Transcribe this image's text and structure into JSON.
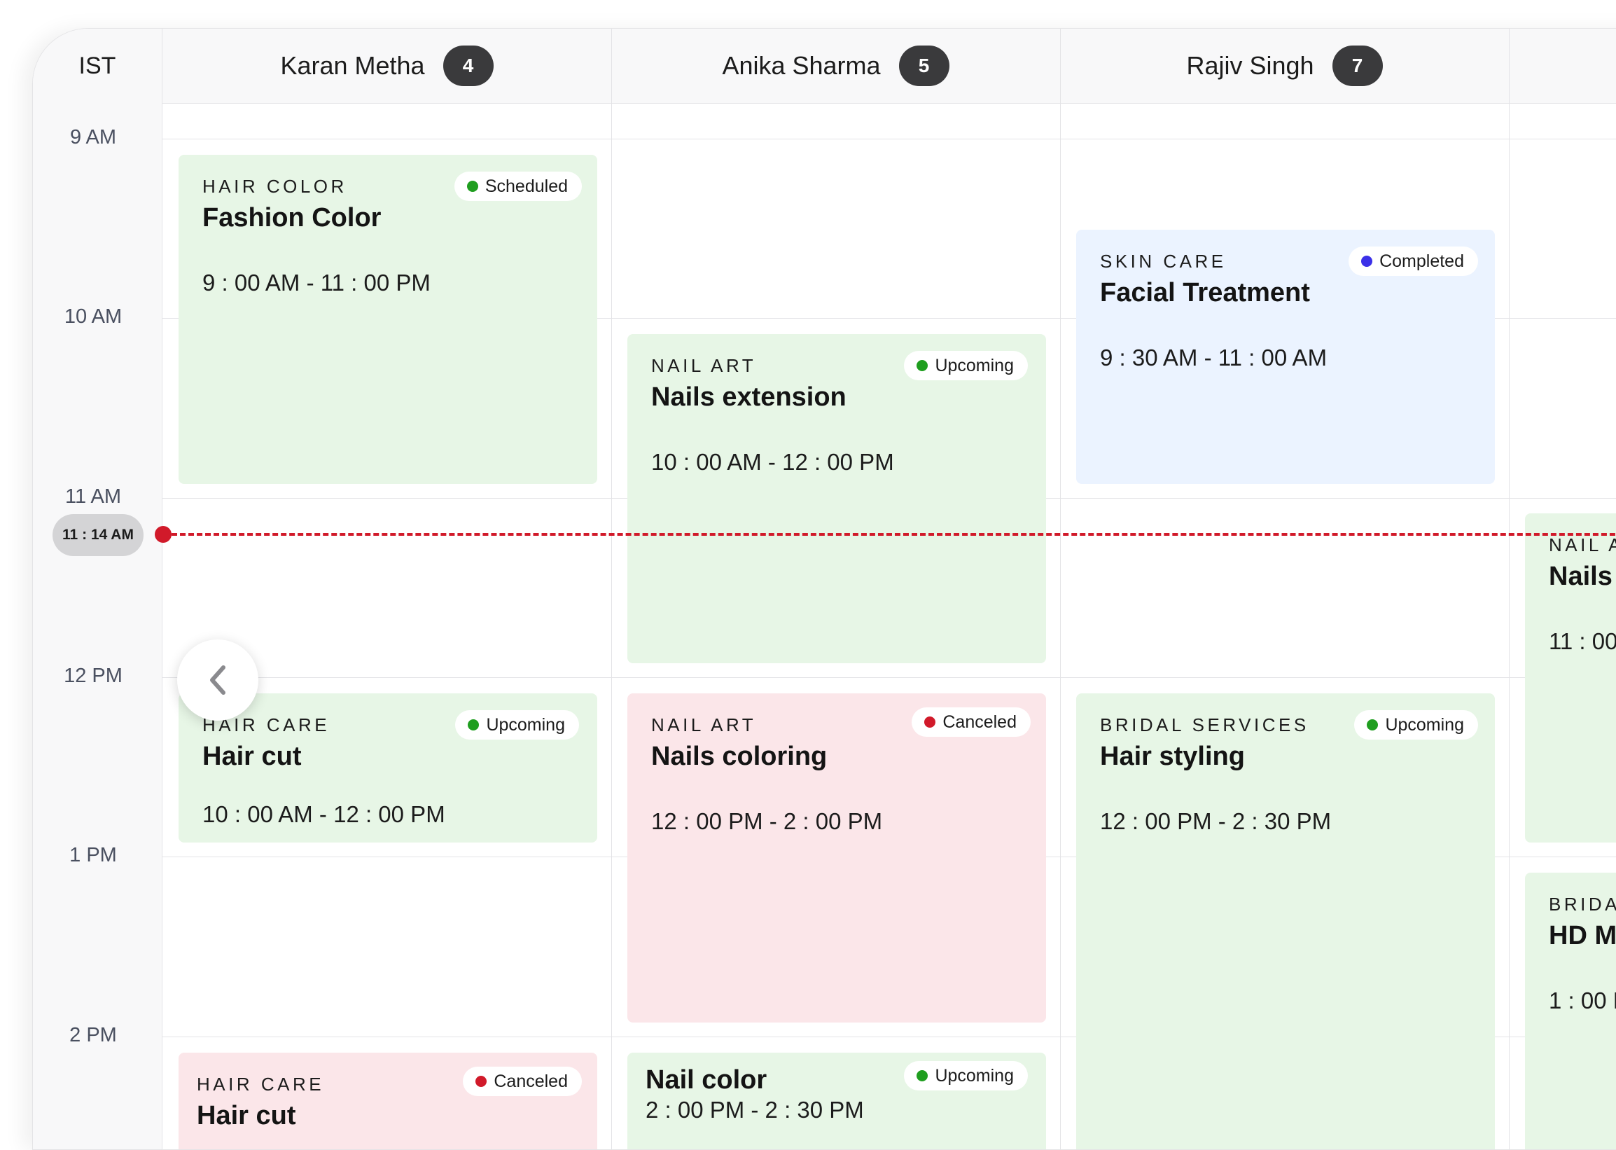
{
  "timezone": "IST",
  "staff": [
    {
      "name": "Karan Metha",
      "count": "4"
    },
    {
      "name": "Anika Sharma",
      "count": "5"
    },
    {
      "name": "Rajiv Singh",
      "count": "7"
    }
  ],
  "hours": [
    "9 AM",
    "10 AM",
    "11 AM",
    "12 PM",
    "1 PM",
    "2 PM"
  ],
  "current_time": "11 : 14 AM",
  "status_colors": {
    "Scheduled": "#1f9e1f",
    "Upcoming": "#1f9e1f",
    "Completed": "#3b30e8",
    "Canceled": "#d11a2a"
  },
  "appointments": [
    {
      "category": "HAIR COLOR",
      "title": "Fashion Color",
      "time": "9 : 00 AM - 11 : 00 PM",
      "status": "Scheduled"
    },
    {
      "category": "NAIL ART",
      "title": "Nails extension",
      "time": "10 : 00 AM - 12 : 00 PM",
      "status": "Upcoming"
    },
    {
      "category": "SKIN CARE",
      "title": "Facial Treatment",
      "time": "9 : 30 AM - 11 : 00 AM",
      "status": "Completed"
    },
    {
      "category": "NAIL A",
      "title": "Nails",
      "time": "11 : 00"
    },
    {
      "category": "HAIR CARE",
      "title": "Hair cut",
      "time": "10 : 00 AM - 12 : 00 PM",
      "status": "Upcoming"
    },
    {
      "category": "NAIL ART",
      "title": "Nails coloring",
      "time": "12 : 00 PM - 2 : 00 PM",
      "status": "Canceled"
    },
    {
      "category": "BRIDAL SERVICES",
      "title": "Hair styling",
      "time": "12 : 00 PM - 2 : 30 PM",
      "status": "Upcoming"
    },
    {
      "category": "BRIDA",
      "title": "HD M",
      "time": "1 : 00 P"
    },
    {
      "category": "HAIR CARE",
      "title": "Hair cut",
      "status": "Canceled"
    },
    {
      "title": "Nail color",
      "time": "2 : 00 PM - 2 : 30 PM",
      "status": "Upcoming"
    }
  ]
}
